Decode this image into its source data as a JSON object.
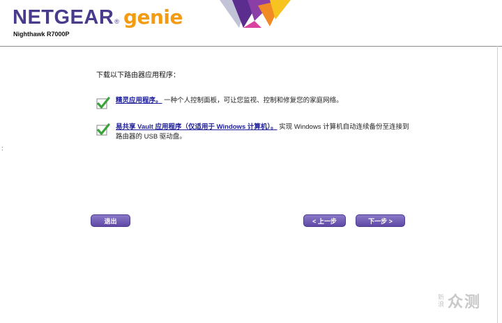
{
  "header": {
    "brand_netgear": "NETGEAR",
    "brand_reg": "®",
    "brand_genie": "genie",
    "model": "Nighthawk R7000P"
  },
  "left_mark": ":",
  "content": {
    "heading": "下载以下路由器应用程序：",
    "items": [
      {
        "link": "精灵应用程序。",
        "desc": "一种个人控制面板，可让您监视、控制和修复您的家庭网络。",
        "checked": true
      },
      {
        "link": "易共享 Vault 应用程序（仅适用于 Windows 计算机）。",
        "desc": "实现 Windows 计算机自动连续备份至连接到路由器的 USB 驱动盘。",
        "checked": true
      }
    ]
  },
  "buttons": {
    "exit": "退出",
    "back": "< 上一步",
    "next": "下一步 >"
  },
  "watermark": {
    "small": "新浪",
    "big": "众测"
  },
  "colors": {
    "brand_purple": "#4a3a8c",
    "brand_orange": "#f39c12",
    "button_purple": "#6b58b2",
    "check_green": "#3aa23a",
    "link_blue": "#1f1f9a"
  }
}
